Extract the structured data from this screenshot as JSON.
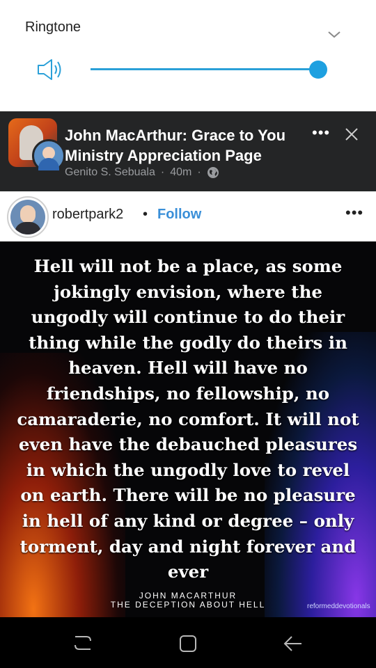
{
  "volume_panel": {
    "title": "Ringtone",
    "level": 1.0,
    "icons": {
      "speaker": "speaker-icon",
      "collapse": "chevron-down-icon"
    },
    "accent_color": "#1ea0e0"
  },
  "fb_post": {
    "page_name": "John MacArthur: Grace to You Ministry Appreciation Page",
    "author": "Genito S. Sebuala",
    "separator": "·",
    "time": "40m",
    "privacy_icon": "globe-icon",
    "more_icon": "more-options-icon",
    "close_icon": "close-icon"
  },
  "ig_post": {
    "username": "robertpark2",
    "separator": "•",
    "follow_label": "Follow",
    "follow_color": "#3a8fd8",
    "more_icon": "more-options-icon"
  },
  "quote_image": {
    "text": "Hell will not be a place, as some jokingly envision, where the ungodly will continue to do their thing while the godly do theirs in heaven. Hell will have no friendships, no fellowship, no camaraderie, no comfort. It will not even have the debauched pleasures in which the ungodly love to revel on earth. There will be no pleasure in hell of any kind or degree – only torment, day and night forever and ever",
    "author_line1": "JOHN MACARTHUR",
    "author_line2": "THE DECEPTION ABOUT HELL",
    "watermark": "reformeddevotionals"
  },
  "nav_bar": {
    "icons": [
      "recent-apps-icon",
      "home-icon",
      "back-icon"
    ]
  }
}
